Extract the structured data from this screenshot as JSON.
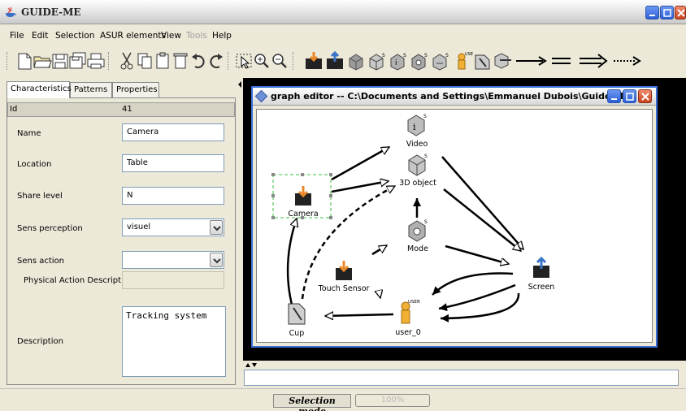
{
  "window": {
    "title": "GUIDE-ME"
  },
  "menu": [
    "File",
    "Edit",
    "Selection",
    "ASUR elements",
    "View",
    "Tools",
    "Help"
  ],
  "menu_disabled": [
    "Tools"
  ],
  "toolbar": {
    "icons": [
      "new-file-icon",
      "open-folder-icon",
      "save-icon",
      "save-all-icon",
      "print-icon",
      "cut-icon",
      "copy-icon",
      "paste-icon",
      "delete-icon",
      "undo-icon",
      "redo-icon",
      "select-pointer-icon",
      "zoom-in-icon",
      "zoom-out-icon",
      "adapter-input-icon",
      "adapter-output-icon",
      "physical-object-icon",
      "computer-object-icon",
      "computer-tool-icon",
      "computer-process-icon",
      "user-icon",
      "physical-tool-icon",
      "computer-physical-icon",
      "arrow-relation-icon",
      "equals-relation-icon",
      "double-arrow-relation-icon",
      "dotted-arrow-relation-icon"
    ]
  },
  "tabs": [
    "Characteristics",
    "Patterns",
    "Properties"
  ],
  "properties": {
    "id_label": "Id",
    "id_value": "41",
    "name_label": "Name",
    "name_value": "Camera",
    "location_label": "Location",
    "location_value": "Table",
    "share_label": "Share level",
    "share_value": "N",
    "sens_perception_label": "Sens perception",
    "sens_perception_value": "visuel",
    "sens_action_label": "Sens action",
    "sens_action_value": "",
    "physical_action_label": "Physical Action Description",
    "physical_action_value": "",
    "description_label": "Description",
    "description_value": "Tracking system"
  },
  "graph_editor": {
    "title": "graph editor -- C:\\Documents and Settings\\Emmanuel Dubois\\Guide-M...",
    "nodes": {
      "video": "Video",
      "obj3d": "3D object",
      "camera": "Camera",
      "mode": "Mode",
      "touch": "Touch Sensor",
      "screen": "Screen",
      "cup": "Cup",
      "user": "user_0"
    },
    "badges": {
      "s": "S",
      "user": "USER"
    }
  },
  "status": {
    "mode": "Selection mode",
    "progress_text": "100%",
    "progress_fraction": 1.0
  }
}
